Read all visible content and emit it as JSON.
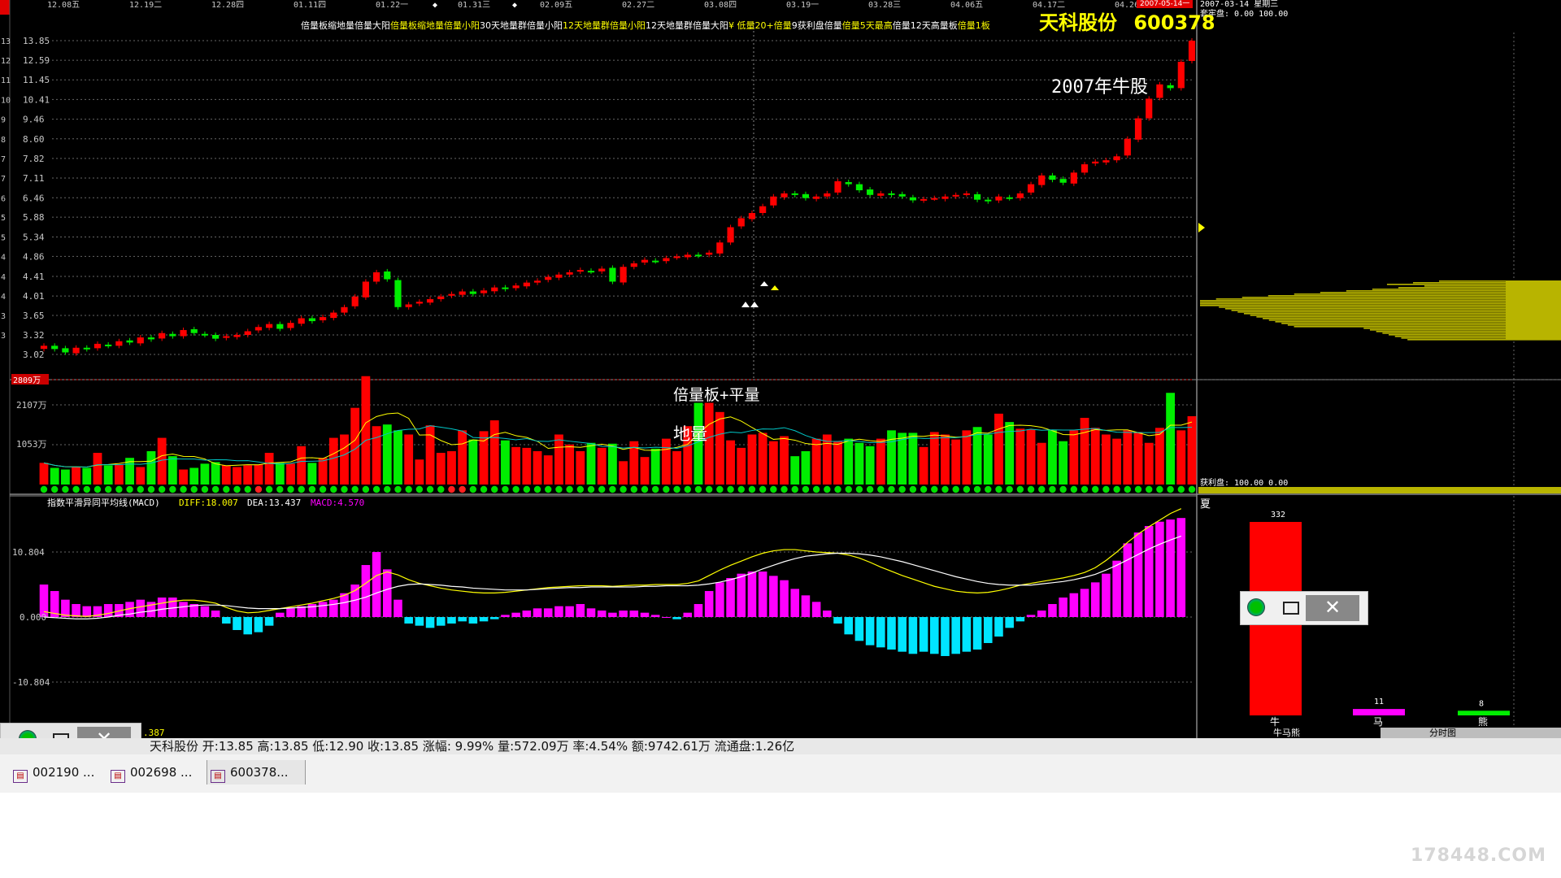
{
  "dates": [
    "12.08五",
    "12.19二",
    "12.28四",
    "01.11四",
    "01.22一",
    "01.31三",
    "02.09五",
    "02.27二",
    "03.08四",
    "03.19一",
    "03.28三",
    "04.06五",
    "04.17二",
    "04.26四"
  ],
  "date_badge": "2007-05-14一",
  "header": {
    "signals": [
      {
        "text": "倍量板缩地量倍量大阳",
        "color": "#ffffff"
      },
      {
        "text": "倍量板缩地量倍量小阳",
        "color": "#ffff00"
      },
      {
        "text": "30天地量群倍量小阳",
        "color": "#ffffff"
      },
      {
        "text": "12天地量群倍量小阳",
        "color": "#ffff00"
      },
      {
        "text": "12天地量群倍量大阳",
        "color": "#ffffff"
      },
      {
        "text": "¥ 低量20+倍量",
        "color": "#ffff00"
      },
      {
        "text": "9获利盘",
        "color": "#ffffff"
      },
      {
        "text": "倍量",
        "color": "#ffffff"
      },
      {
        "text": "倍量5天最高",
        "color": "#ffff00"
      },
      {
        "text": "倍量12天高量板",
        "color": "#ffffff"
      },
      {
        "text": "倍量1板",
        "color": "#ffff00"
      }
    ],
    "stock_name": "天科股份",
    "stock_code": "600378"
  },
  "price_axis": [
    "13.85",
    "12.59",
    "11.45",
    "10.41",
    "9.46",
    "8.60",
    "7.82",
    "7.11",
    "6.46",
    "5.88",
    "5.34",
    "4.86",
    "4.41",
    "4.01",
    "3.65",
    "3.32",
    "3.02"
  ],
  "left_edge_labels": [
    "13",
    "12",
    "11",
    "10",
    "9",
    "8",
    "7",
    "7",
    "6",
    "5",
    "5",
    "4",
    "4",
    "4",
    "3",
    "3"
  ],
  "annotations": {
    "bull_stock": "2007年牛股",
    "vol_note": "倍量板+平量",
    "low_vol": "地量"
  },
  "volume_axis": {
    "max": "2809万",
    "mid": "2107万",
    "low": "1053万"
  },
  "macd": {
    "title": "指数平滑异同平均线(MACD)",
    "diff_label": "DIFF:18.007",
    "dea_label": "DEA:13.437",
    "macd_label": "MACD:4.570",
    "levels": [
      "10.804",
      "0.000",
      "-10.804"
    ],
    "bottom_label": ".387"
  },
  "chip": {
    "date": "2007-03-14 星期三",
    "trap_label": "套牢盘: 0.00 100.00",
    "profit_label": "获利盘: 100.00 0.00"
  },
  "bull_bear": {
    "title": "夏",
    "bars": [
      {
        "label": "牛",
        "value": 332,
        "color": "#ff0000"
      },
      {
        "label": "马",
        "value": 11,
        "color": "#ff00ff"
      },
      {
        "label": "熊",
        "value": 8,
        "color": "#00ee00"
      }
    ],
    "tab_left": "牛马熊",
    "tab_right": "分时图"
  },
  "info_bar": "天科股份 开:13.85 高:13.85 低:12.90 收:13.85 涨幅: 9.99% 量:572.09万 率:4.54% 额:9742.61万 流通盘:1.26亿",
  "taskbar": {
    "items": [
      "002190 ...",
      "002698 ...",
      "600378..."
    ]
  },
  "watermark": "178448.COM",
  "colors": {
    "up": "#ff0000",
    "down": "#00ee00",
    "macd_pos": "#ff00ff",
    "macd_neg": "#00e5ff",
    "diff": "#ffff00",
    "dea": "#ffffff",
    "chip": "#b8b400"
  },
  "chart_data": {
    "type": "candlestick",
    "closes": [
      3.15,
      3.1,
      3.05,
      3.12,
      3.1,
      3.18,
      3.15,
      3.22,
      3.2,
      3.28,
      3.25,
      3.35,
      3.3,
      3.4,
      3.35,
      3.32,
      3.26,
      3.3,
      3.32,
      3.38,
      3.45,
      3.5,
      3.42,
      3.52,
      3.6,
      3.55,
      3.62,
      3.7,
      3.8,
      4.0,
      4.3,
      4.5,
      4.35,
      3.8,
      3.85,
      3.9,
      3.95,
      4.0,
      4.05,
      4.1,
      4.05,
      4.12,
      4.18,
      4.15,
      4.22,
      4.28,
      4.32,
      4.4,
      4.45,
      4.5,
      4.55,
      4.52,
      4.58,
      4.3,
      4.62,
      4.7,
      4.78,
      4.75,
      4.82,
      4.86,
      4.9,
      4.88,
      4.95,
      5.2,
      5.6,
      5.85,
      6.0,
      6.2,
      6.5,
      6.6,
      6.55,
      6.45,
      6.5,
      6.6,
      7.0,
      6.9,
      6.7,
      6.55,
      6.6,
      6.55,
      6.5,
      6.38,
      6.42,
      6.45,
      6.5,
      6.55,
      6.6,
      6.4,
      6.35,
      6.5,
      6.45,
      6.6,
      6.9,
      7.2,
      7.05,
      6.95,
      7.3,
      7.6,
      7.7,
      7.75,
      7.9,
      8.6,
      9.5,
      10.45,
      11.2,
      11.0,
      12.5,
      13.85
    ],
    "volumes": [
      520,
      400,
      360,
      420,
      400,
      760,
      460,
      480,
      640,
      420,
      800,
      1120,
      680,
      360,
      400,
      500,
      540,
      460,
      420,
      460,
      480,
      760,
      520,
      500,
      920,
      520,
      640,
      1120,
      1200,
      1840,
      2600,
      1400,
      1440,
      1300,
      1200,
      600,
      1420,
      760,
      800,
      1300,
      1080,
      1280,
      1540,
      1060,
      900,
      880,
      800,
      700,
      1200,
      960,
      800,
      1000,
      880,
      980,
      560,
      1040,
      660,
      860,
      1100,
      800,
      1400,
      1960,
      1960,
      1740,
      1060,
      880,
      1200,
      1240,
      1040,
      1160,
      680,
      800,
      1100,
      1200,
      1040,
      1100,
      1000,
      920,
      1100,
      1300,
      1240,
      1240,
      900,
      1260,
      1200,
      1080,
      1300,
      1380,
      1200,
      1700,
      1500,
      1340,
      1320,
      1000,
      1300,
      1040,
      1300,
      1600,
      1360,
      1200,
      1100,
      1300,
      1260,
      1000,
      1360,
      2200,
      1300,
      1640,
      600
    ],
    "macd_hist": [
      1.5,
      1.2,
      0.8,
      0.6,
      0.5,
      0.5,
      0.6,
      0.6,
      0.7,
      0.8,
      0.7,
      0.9,
      0.9,
      0.7,
      0.6,
      0.5,
      0.3,
      -0.3,
      -0.6,
      -0.8,
      -0.7,
      -0.4,
      0.2,
      0.4,
      0.5,
      0.6,
      0.7,
      0.8,
      1.1,
      1.5,
      2.4,
      3.0,
      2.2,
      0.8,
      -0.3,
      -0.4,
      -0.5,
      -0.4,
      -0.3,
      -0.2,
      -0.3,
      -0.2,
      -0.1,
      0.1,
      0.2,
      0.3,
      0.4,
      0.4,
      0.5,
      0.5,
      0.6,
      0.4,
      0.3,
      0.2,
      0.3,
      0.3,
      0.2,
      0.1,
      0.0,
      -0.1,
      0.2,
      0.6,
      1.2,
      1.6,
      1.8,
      2.0,
      2.1,
      2.1,
      1.9,
      1.7,
      1.3,
      1.0,
      0.7,
      0.3,
      -0.3,
      -0.8,
      -1.1,
      -1.3,
      -1.4,
      -1.5,
      -1.6,
      -1.7,
      -1.6,
      -1.7,
      -1.8,
      -1.7,
      -1.6,
      -1.5,
      -1.2,
      -0.9,
      -0.5,
      -0.2,
      0.1,
      0.3,
      0.6,
      0.9,
      1.1,
      1.3,
      1.6,
      2.0,
      2.6,
      3.4,
      3.9,
      4.2,
      4.4,
      4.5,
      4.57
    ],
    "diff": [
      0.9,
      0.6,
      0.3,
      0.2,
      0.1,
      0.3,
      0.6,
      1.0,
      1.4,
      1.7,
      2.0,
      2.3,
      2.6,
      2.8,
      2.8,
      2.6,
      2.3,
      1.6,
      1.0,
      0.7,
      0.8,
      1.1,
      1.4,
      1.7,
      2.0,
      2.3,
      2.7,
      3.1,
      3.6,
      4.4,
      5.6,
      6.9,
      7.5,
      7.0,
      6.2,
      5.6,
      5.2,
      4.8,
      4.5,
      4.3,
      4.1,
      4.0,
      4.0,
      4.1,
      4.3,
      4.5,
      4.7,
      4.9,
      5.0,
      5.1,
      5.2,
      5.2,
      5.2,
      5.1,
      5.2,
      5.3,
      5.3,
      5.4,
      5.4,
      5.4,
      5.6,
      6.0,
      6.9,
      7.8,
      8.6,
      9.3,
      10.0,
      10.6,
      11.0,
      11.2,
      11.2,
      11.0,
      10.8,
      10.7,
      10.6,
      10.3,
      9.8,
      9.1,
      8.3,
      7.6,
      6.9,
      6.3,
      5.7,
      5.1,
      4.7,
      4.3,
      4.1,
      4.0,
      4.1,
      4.4,
      4.8,
      5.3,
      5.6,
      5.9,
      6.2,
      6.5,
      6.9,
      7.4,
      8.2,
      9.4,
      10.8,
      12.4,
      13.8,
      15.0,
      16.1,
      17.2,
      18.0
    ],
    "dea": [
      0.0,
      -0.1,
      -0.2,
      -0.3,
      -0.3,
      -0.2,
      0.0,
      0.3,
      0.5,
      0.8,
      1.0,
      1.3,
      1.5,
      1.7,
      1.9,
      2.0,
      2.0,
      1.9,
      1.7,
      1.5,
      1.4,
      1.4,
      1.4,
      1.5,
      1.6,
      1.7,
      1.9,
      2.1,
      2.4,
      2.8,
      3.3,
      4.0,
      4.6,
      5.1,
      5.4,
      5.5,
      5.4,
      5.3,
      5.1,
      5.0,
      4.8,
      4.7,
      4.6,
      4.5,
      4.5,
      4.5,
      4.6,
      4.7,
      4.8,
      4.9,
      4.9,
      5.0,
      5.0,
      5.0,
      5.0,
      5.0,
      5.1,
      5.1,
      5.2,
      5.2,
      5.2,
      5.3,
      5.5,
      5.8,
      6.2,
      6.7,
      7.3,
      8.0,
      8.6,
      9.2,
      9.7,
      10.1,
      10.3,
      10.5,
      10.6,
      10.6,
      10.5,
      10.3,
      10.0,
      9.6,
      9.2,
      8.7,
      8.2,
      7.7,
      7.2,
      6.7,
      6.3,
      5.9,
      5.6,
      5.4,
      5.3,
      5.3,
      5.3,
      5.5,
      5.7,
      5.9,
      6.2,
      6.6,
      7.1,
      7.8,
      8.6,
      9.5,
      10.4,
      11.3,
      12.1,
      12.8,
      13.44
    ],
    "bull_bear_values": [
      332,
      11,
      8
    ]
  }
}
